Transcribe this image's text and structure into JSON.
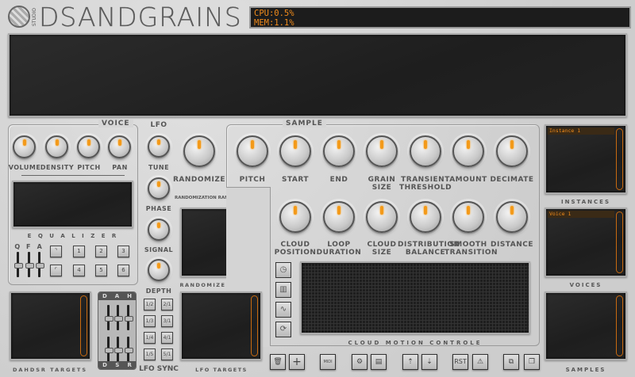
{
  "app": {
    "logo_studio": "STUDIO",
    "logo_text": "DSANDGRAINS",
    "cpu": "CPU:0.5%",
    "mem": "MEM:1.1%"
  },
  "voice": {
    "title": "VOICE",
    "knobs": [
      "VOLUME",
      "DENSITY",
      "PITCH",
      "PAN"
    ],
    "equalizer_label": "E Q U A L I Z E R",
    "sliders": [
      "Q",
      "F",
      "A"
    ],
    "buttons": [
      "1",
      "2",
      "3",
      "4",
      "5",
      "6"
    ]
  },
  "lfo": {
    "title": "LFO",
    "knobs": [
      "TUNE",
      "PHASE",
      "SIGNAL",
      "DEPTH"
    ],
    "sync_label": "LFO SYNC",
    "sync_buttons": [
      "1/2",
      "2/1",
      "1/3",
      "3/1",
      "1/4",
      "4/1",
      "1/5",
      "5/1"
    ],
    "targets_label": "LFO TARGETS"
  },
  "randomize": {
    "knob": "RANDOMIZE",
    "range_label": "RANDOMIZATION RANGE",
    "minus": "−",
    "plus": "+",
    "targets_label": "RANDOMIZE TARGETS"
  },
  "sample": {
    "title": "SAMPLE",
    "row1": [
      "PITCH",
      "START",
      "END",
      "GRAIN SIZE",
      "TRANSIENT THRESHOLD",
      "AMOUNT",
      "DECIMATE"
    ],
    "row2": [
      "CLOUD POSITION",
      "LOOP DURATION",
      "CLOUD SIZE",
      "DISTRIBUTION BALANCE",
      "SMOOTH TRANSITION",
      "DISTANCE"
    ],
    "cloud_label": "CLOUD MOTION CONTROLE"
  },
  "dahdsr": {
    "top": [
      "D",
      "A",
      "H"
    ],
    "bottom": [
      "D",
      "S",
      "R"
    ],
    "targets_label": "DAHDSR TARGETS"
  },
  "lists": {
    "instances_label": "INSTANCES",
    "instance_item": "Instance 1",
    "voices_label": "VOICES",
    "voice_item": "Voice 1",
    "samples_label": "SAMPLES"
  },
  "toolbar": {
    "midi": "MIDI",
    "rst": "RST",
    "add": "+"
  },
  "colors": {
    "accent": "#f08a1a",
    "screen": "#1e1e1e",
    "panel": "#d4d4d4"
  }
}
